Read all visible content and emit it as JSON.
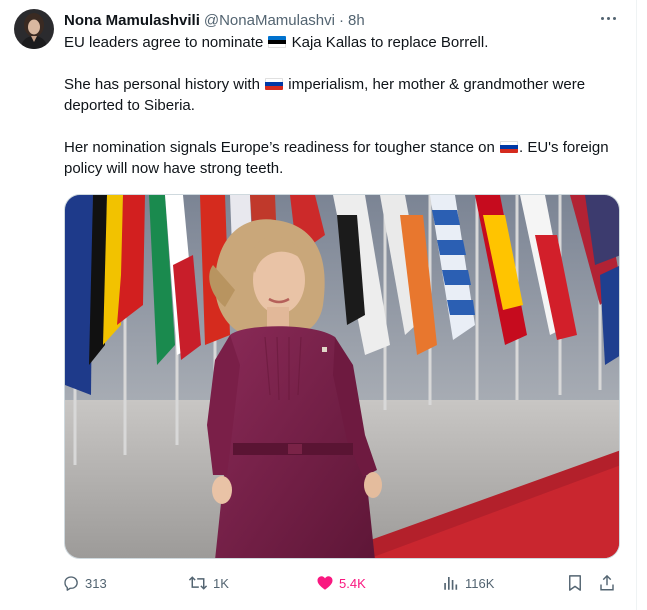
{
  "author": {
    "name": "Nona Mamulashvili",
    "handle": "@NonaMamulashvi",
    "separator": "·",
    "time": "8h"
  },
  "tweet": {
    "p1_before": "EU leaders agree to nominate ",
    "p1_after": " Kaja Kallas to replace Borrell.",
    "p2_before": "She has personal history with ",
    "p2_after": " imperialism, her mother & grandmother were deported to Siberia.",
    "p3_before": "Her nomination signals Europe’s readiness for tougher stance on ",
    "p3_after": ". EU's foreign policy will now have strong teeth."
  },
  "flags": {
    "estonia": [
      "#0072ce",
      "#000000",
      "#ffffff"
    ],
    "russia": [
      "#ffffff",
      "#0039a6",
      "#d52b1e"
    ]
  },
  "actions": {
    "replies": "313",
    "reposts": "1K",
    "likes": "5.4K",
    "views": "116K"
  },
  "icons": {
    "reply": "speech-bubble-icon",
    "repost": "repost-arrows-icon",
    "like": "heart-icon",
    "views": "bar-chart-icon",
    "bookmark": "bookmark-icon",
    "share": "share-upload-icon",
    "more": "three-dots-icon"
  },
  "colors": {
    "text": "#0f1419",
    "secondary": "#536471",
    "like": "#f91880",
    "border": "#cfd9de"
  }
}
